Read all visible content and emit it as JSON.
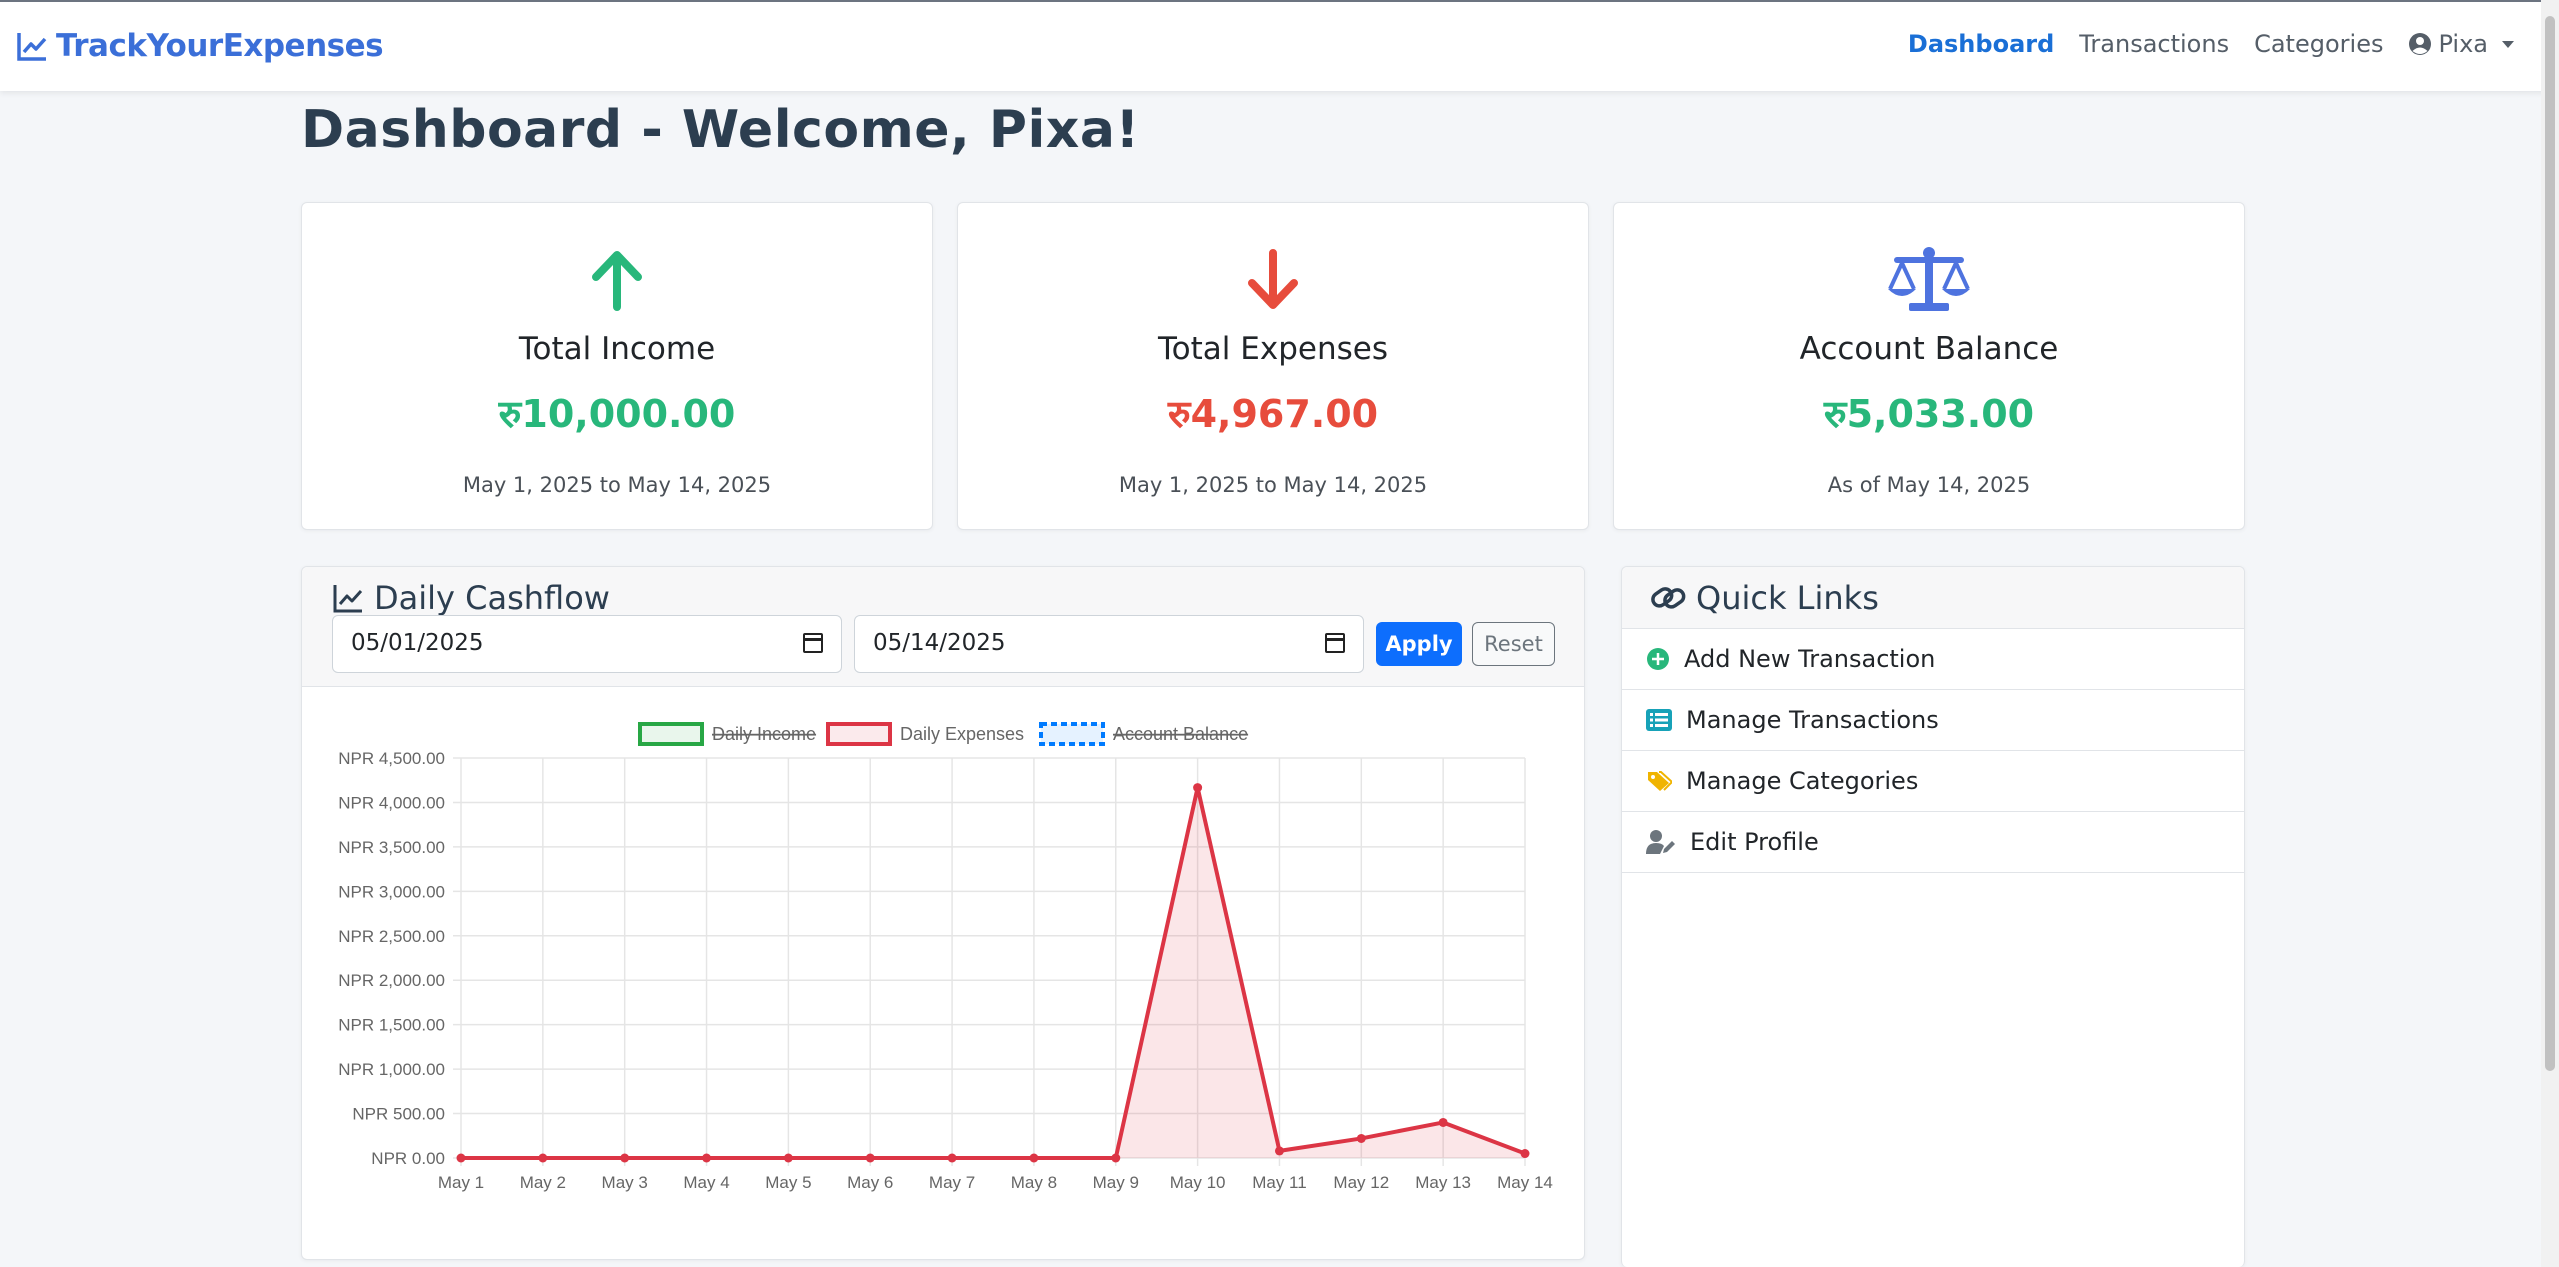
{
  "navbar": {
    "brand": "TrackYourExpenses",
    "items": [
      {
        "label": "Dashboard",
        "active": true
      },
      {
        "label": "Transactions",
        "active": false
      },
      {
        "label": "Categories",
        "active": false
      }
    ],
    "user": "Pixa"
  },
  "page": {
    "title": "Dashboard - Welcome, Pixa!"
  },
  "stats": {
    "income": {
      "label": "Total Income",
      "amount": "रु10,000.00",
      "period": "May 1, 2025 to May 14, 2025",
      "icon": "arrow-up-icon",
      "color": "#28b77b"
    },
    "expenses": {
      "label": "Total Expenses",
      "amount": "रु4,967.00",
      "period": "May 1, 2025 to May 14, 2025",
      "icon": "arrow-down-icon",
      "color": "#e74c3c"
    },
    "balance": {
      "label": "Account Balance",
      "amount": "रु5,033.00",
      "period": "As of May 14, 2025",
      "icon": "balance-scale-icon",
      "color": "#4e73df"
    }
  },
  "cashflow": {
    "title": "Daily Cashflow",
    "start_date": "05/01/2025",
    "end_date": "05/14/2025",
    "apply_label": "Apply",
    "reset_label": "Reset"
  },
  "quick_links": {
    "title": "Quick Links",
    "items": [
      {
        "label": "Add New Transaction",
        "icon": "plus-circle-icon"
      },
      {
        "label": "Manage Transactions",
        "icon": "list-icon"
      },
      {
        "label": "Manage Categories",
        "icon": "tags-icon"
      },
      {
        "label": "Edit Profile",
        "icon": "user-edit-icon"
      }
    ]
  },
  "chart_data": {
    "type": "line",
    "x": [
      "May 1",
      "May 2",
      "May 3",
      "May 4",
      "May 5",
      "May 6",
      "May 7",
      "May 8",
      "May 9",
      "May 10",
      "May 11",
      "May 12",
      "May 13",
      "May 14"
    ],
    "series": [
      {
        "name": "Daily Income",
        "hidden": true,
        "color": "#28a745",
        "values": []
      },
      {
        "name": "Daily Expenses",
        "hidden": false,
        "color": "#dc3545",
        "values": [
          0,
          0,
          0,
          0,
          0,
          0,
          0,
          0,
          0,
          4167,
          80,
          220,
          400,
          50
        ]
      },
      {
        "name": "Account Balance",
        "hidden": true,
        "color": "#007bff",
        "values": []
      }
    ],
    "y_ticks": [
      "NPR 0.00",
      "NPR 500.00",
      "NPR 1,000.00",
      "NPR 1,500.00",
      "NPR 2,000.00",
      "NPR 2,500.00",
      "NPR 3,000.00",
      "NPR 3,500.00",
      "NPR 4,000.00",
      "NPR 4,500.00"
    ],
    "ylim": [
      0,
      4500
    ],
    "legend_position": "top",
    "grid": true
  }
}
